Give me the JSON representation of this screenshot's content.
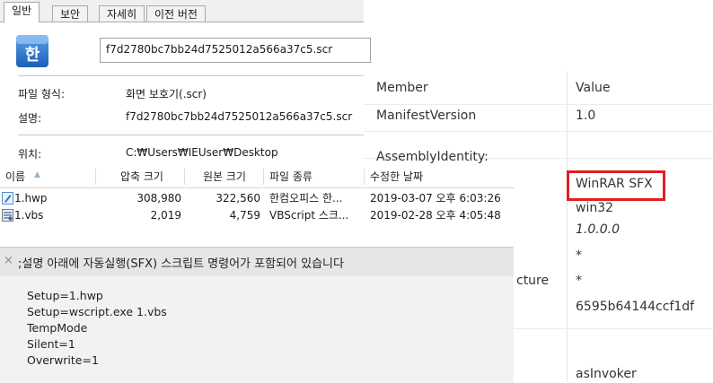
{
  "properties": {
    "tabs": [
      "일반",
      "보안",
      "자세히",
      "이전 버전"
    ],
    "filename": "f7d2780bc7bb24d7525012a566a37c5.scr",
    "rows": [
      {
        "label": "파일 형식:",
        "value": "화면 보호기(.scr)"
      },
      {
        "label": "설명:",
        "value": "f7d2780bc7bb24d7525012a566a37c5.scr"
      },
      {
        "label": "위치:",
        "value": "C:₩Users₩IEUser₩Desktop"
      }
    ],
    "icon": "hancom-app-icon"
  },
  "archive": {
    "columns": [
      "이름",
      "압축 크기",
      "원본 크기",
      "파일 종류",
      "수정한 날짜"
    ],
    "rows": [
      {
        "name": "1.hwp",
        "packed": "308,980",
        "size": "322,560",
        "type": "한컴오피스 한...",
        "modified": "2019-03-07 오후 6:03:26",
        "icon": "hwp-file-icon"
      },
      {
        "name": "1.vbs",
        "packed": "2,019",
        "size": "4,759",
        "type": "VBScript 스크...",
        "modified": "2019-02-28 오후 4:05:48",
        "icon": "vbs-file-icon"
      }
    ]
  },
  "comment": {
    "close_glyph": "×",
    "title": ";설명 아래에 자동실행(SFX) 스크립트 명령어가 포함되어 있습니다",
    "lines": [
      "Setup=1.hwp",
      "Setup=wscript.exe 1.vbs",
      "TempMode",
      "Silent=1",
      "Overwrite=1"
    ]
  },
  "manifest": {
    "headers": [
      "Member",
      "Value"
    ],
    "rows": [
      {
        "member": "ManifestVersion",
        "value": ""
      },
      {
        "member": "AssemblyIdentity:",
        "value": ""
      },
      {
        "member": "",
        "value": "WinRAR SFX"
      },
      {
        "member": "",
        "value": "win32"
      },
      {
        "member": "",
        "value": "1.0.0.0"
      },
      {
        "member": "",
        "value": "*"
      },
      {
        "member": "cture",
        "value": "*"
      },
      {
        "member": "",
        "value": "6595b64144ccf1df"
      },
      {
        "member": "",
        "value": "asInvoker"
      }
    ],
    "manifest_version_value": "1.0",
    "highlight_color": "#e02020"
  }
}
